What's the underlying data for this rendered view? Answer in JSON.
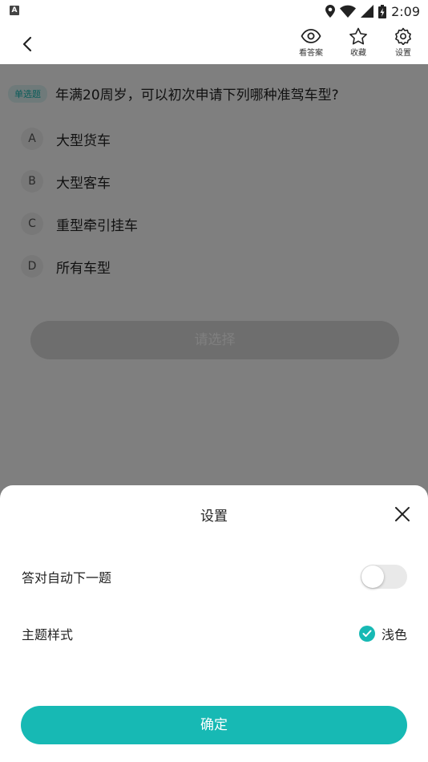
{
  "status_bar": {
    "badge": "A",
    "time": "2:09",
    "icons": [
      "location-icon",
      "wifi-icon",
      "signal-icon",
      "battery-icon"
    ]
  },
  "nav": {
    "back_icon": "chevron-left-icon",
    "actions": [
      {
        "label": "看答案",
        "icon": "eye-icon"
      },
      {
        "label": "收藏",
        "icon": "star-icon"
      },
      {
        "label": "设置",
        "icon": "gear-icon"
      }
    ]
  },
  "question": {
    "type_tag": "单选题",
    "text": "年满20周岁，可以初次申请下列哪种准驾车型?",
    "options": [
      {
        "letter": "A",
        "text": "大型货车"
      },
      {
        "letter": "B",
        "text": "大型客车"
      },
      {
        "letter": "C",
        "text": "重型牵引挂车"
      },
      {
        "letter": "D",
        "text": "所有车型"
      }
    ],
    "submit_label": "请选择"
  },
  "settings_sheet": {
    "title": "设置",
    "close_icon": "close-icon",
    "auto_next": {
      "label": "答对自动下一题",
      "enabled": false
    },
    "theme": {
      "label": "主题样式",
      "selected": "浅色"
    },
    "confirm_label": "确定"
  },
  "colors": {
    "accent": "#17b9b4",
    "overlay": "rgba(0,0,0,0.5)",
    "toggle_off": "#e9e9e9"
  }
}
